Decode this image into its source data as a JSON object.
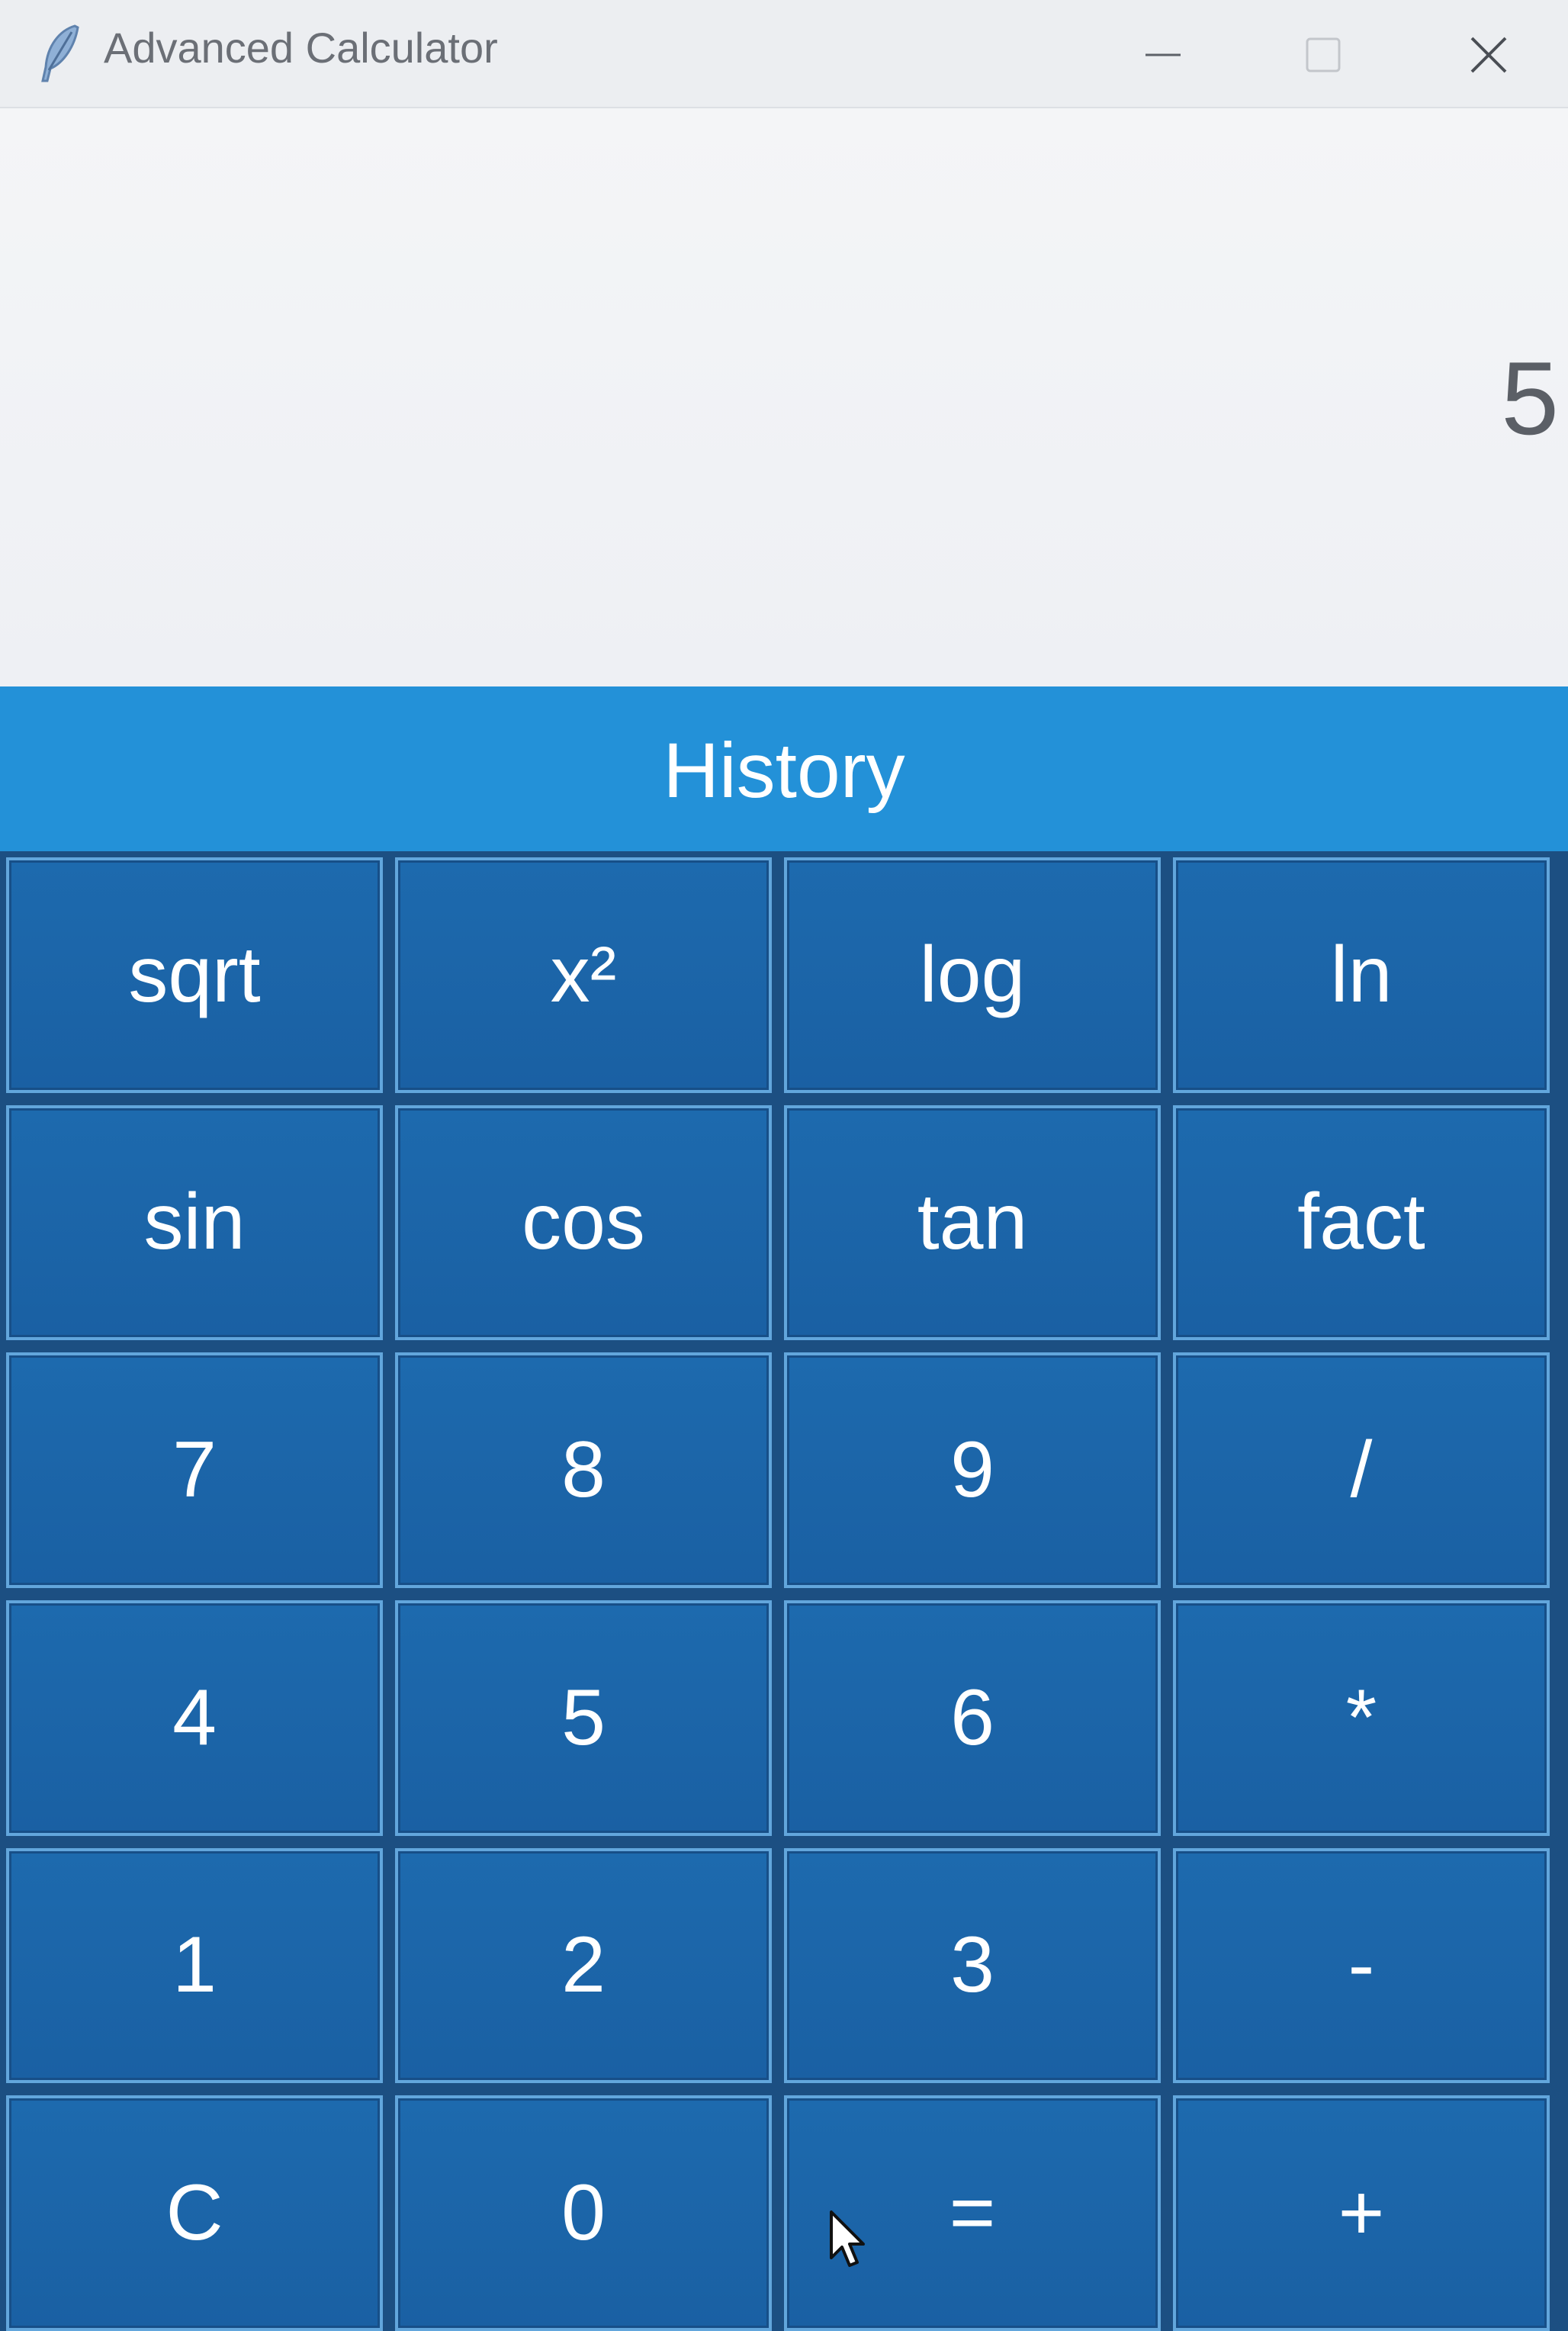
{
  "window": {
    "title": "Advanced Calculator",
    "app_icon": "feather-icon",
    "controls": [
      "minimize-icon",
      "maximize-icon",
      "close-icon"
    ]
  },
  "display": {
    "value": "5"
  },
  "history": {
    "label": "History"
  },
  "keys": {
    "sqrt": "sqrt",
    "square": "x²",
    "log": "log",
    "ln": "ln",
    "sin": "sin",
    "cos": "cos",
    "tan": "tan",
    "fact": "fact",
    "seven": "7",
    "eight": "8",
    "nine": "9",
    "divide": "/",
    "four": "4",
    "five": "5",
    "six": "6",
    "multiply": "*",
    "one": "1",
    "two": "2",
    "three": "3",
    "subtract": "-",
    "clear": "C",
    "zero": "0",
    "equals": "=",
    "add": "+"
  },
  "colors": {
    "accent": "#2391d8",
    "key_fill": "#1d6aae",
    "key_border": "#62a6dc",
    "display_text": "#5b5f66"
  }
}
